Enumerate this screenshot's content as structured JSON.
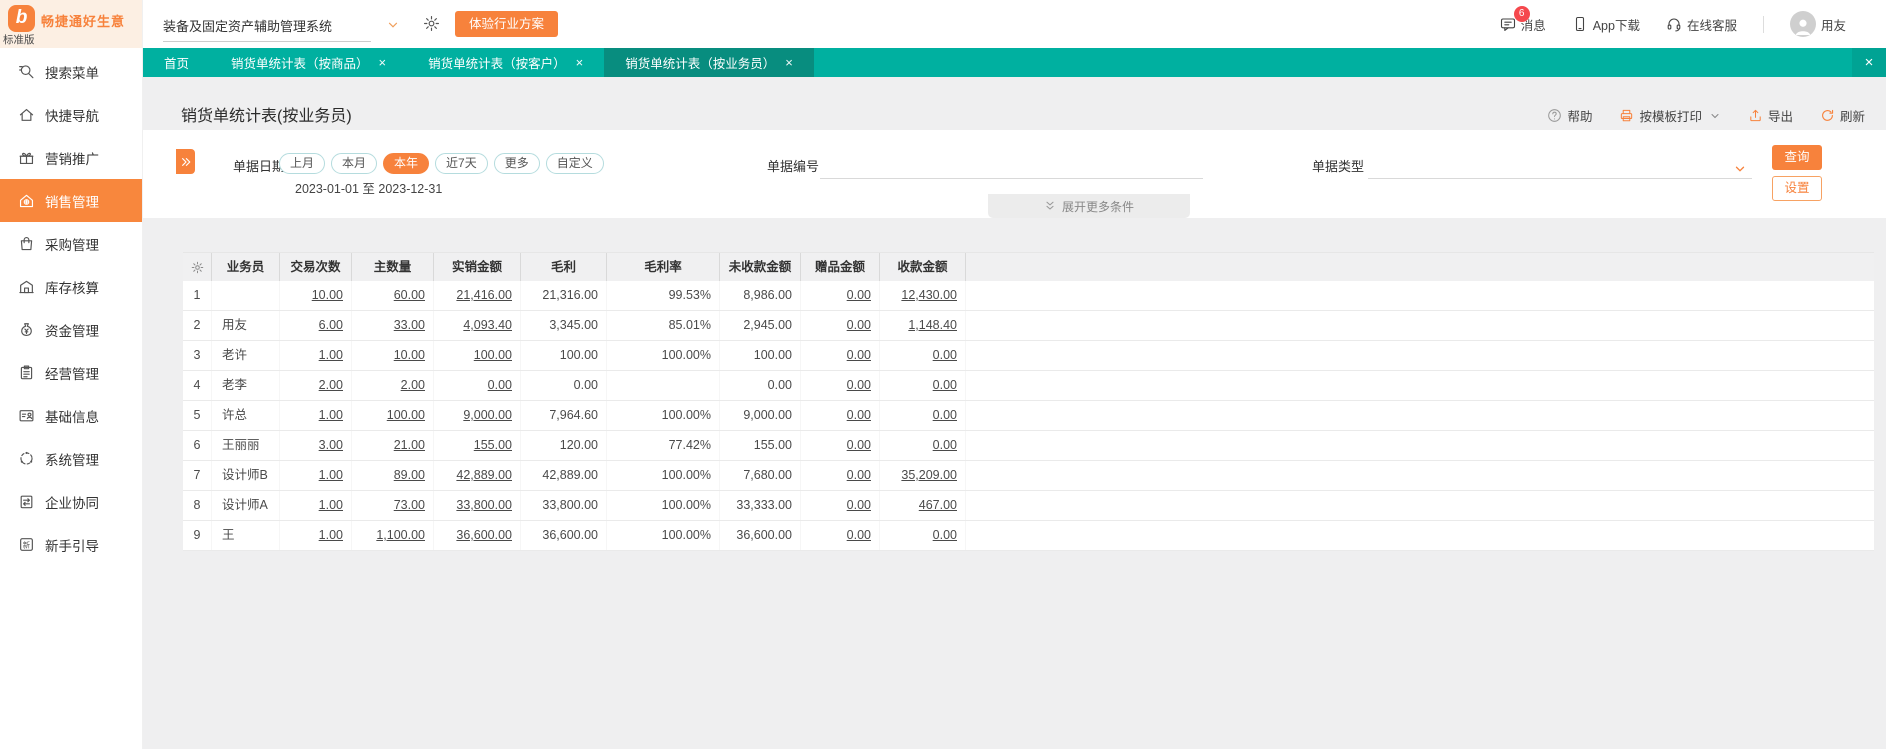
{
  "brand": {
    "logo_glyph": "b",
    "name": "畅捷通好生意",
    "edition": "标准版"
  },
  "topbar": {
    "system_select": "装备及固定资产辅助管理系统",
    "trial_button": "体验行业方案",
    "messages": "消息",
    "messages_badge": "6",
    "app_download": "App下载",
    "online_service": "在线客服",
    "username": "用友"
  },
  "tabbar": {
    "close_glyph": "×"
  },
  "tabs": [
    {
      "label": "首页",
      "closable": false,
      "active": false
    },
    {
      "label": "销货单统计表（按商品）",
      "closable": true,
      "active": false
    },
    {
      "label": "销货单统计表（按客户）",
      "closable": true,
      "active": false
    },
    {
      "label": "销货单统计表（按业务员）",
      "closable": true,
      "active": true
    }
  ],
  "sidebar": {
    "items": [
      {
        "label": "搜索菜单",
        "icon": "search-icon",
        "active": false
      },
      {
        "label": "快捷导航",
        "icon": "home-icon",
        "active": false
      },
      {
        "label": "营销推广",
        "icon": "gift-icon",
        "active": false
      },
      {
        "label": "销售管理",
        "icon": "sales-icon",
        "active": true
      },
      {
        "label": "采购管理",
        "icon": "purchase-bag-icon",
        "active": false
      },
      {
        "label": "库存核算",
        "icon": "warehouse-icon",
        "active": false
      },
      {
        "label": "资金管理",
        "icon": "money-bag-icon",
        "active": false
      },
      {
        "label": "经营管理",
        "icon": "report-clipboard-icon",
        "active": false
      },
      {
        "label": "基础信息",
        "icon": "id-card-icon",
        "active": false
      },
      {
        "label": "系统管理",
        "icon": "system-icon",
        "active": false
      },
      {
        "label": "企业协同",
        "icon": "collaboration-icon",
        "active": false
      },
      {
        "label": "新手引导",
        "icon": "guide-icon",
        "active": false
      }
    ]
  },
  "page": {
    "title": "销货单统计表(按业务员)",
    "toolbar": {
      "help": "帮助",
      "print": "按模板打印",
      "export": "导出",
      "refresh": "刷新"
    }
  },
  "filters": {
    "date_label": "单据日期",
    "date_pills": [
      {
        "label": "上月",
        "active": false
      },
      {
        "label": "本月",
        "active": false
      },
      {
        "label": "本年",
        "active": true
      },
      {
        "label": "近7天",
        "active": false
      },
      {
        "label": "更多",
        "active": false
      },
      {
        "label": "自定义",
        "active": false
      }
    ],
    "date_range": "2023-01-01 至 2023-12-31",
    "doc_no_label": "单据编号",
    "doc_no_value": "",
    "doc_type_label": "单据类型",
    "doc_type_value": "",
    "search_button": "查询",
    "settings_button": "设置",
    "expand_more": "展开更多条件"
  },
  "table": {
    "columns": [
      "业务员",
      "交易次数",
      "主数量",
      "实销金额",
      "毛利",
      "毛利率",
      "未收款金额",
      "赠品金额",
      "收款金额"
    ],
    "rows": [
      {
        "num": "1",
        "name": "",
        "trades": "10.00",
        "qty": "60.00",
        "sales": "21,416.00",
        "profit": "21,316.00",
        "margin": "99.53%",
        "unpaid": "8,986.00",
        "gift": "0.00",
        "received": "12,430.00"
      },
      {
        "num": "2",
        "name": "用友",
        "trades": "6.00",
        "qty": "33.00",
        "sales": "4,093.40",
        "profit": "3,345.00",
        "margin": "85.01%",
        "unpaid": "2,945.00",
        "gift": "0.00",
        "received": "1,148.40"
      },
      {
        "num": "3",
        "name": "老许",
        "trades": "1.00",
        "qty": "10.00",
        "sales": "100.00",
        "profit": "100.00",
        "margin": "100.00%",
        "unpaid": "100.00",
        "gift": "0.00",
        "received": "0.00"
      },
      {
        "num": "4",
        "name": "老李",
        "trades": "2.00",
        "qty": "2.00",
        "sales": "0.00",
        "profit": "0.00",
        "margin": "",
        "unpaid": "0.00",
        "gift": "0.00",
        "received": "0.00"
      },
      {
        "num": "5",
        "name": "许总",
        "trades": "1.00",
        "qty": "100.00",
        "sales": "9,000.00",
        "profit": "7,964.60",
        "margin": "100.00%",
        "unpaid": "9,000.00",
        "gift": "0.00",
        "received": "0.00"
      },
      {
        "num": "6",
        "name": "王丽丽",
        "trades": "3.00",
        "qty": "21.00",
        "sales": "155.00",
        "profit": "120.00",
        "margin": "77.42%",
        "unpaid": "155.00",
        "gift": "0.00",
        "received": "0.00"
      },
      {
        "num": "7",
        "name": "设计师B",
        "trades": "1.00",
        "qty": "89.00",
        "sales": "42,889.00",
        "profit": "42,889.00",
        "margin": "100.00%",
        "unpaid": "7,680.00",
        "gift": "0.00",
        "received": "35,209.00"
      },
      {
        "num": "8",
        "name": "设计师A",
        "trades": "1.00",
        "qty": "73.00",
        "sales": "33,800.00",
        "profit": "33,800.00",
        "margin": "100.00%",
        "unpaid": "33,333.00",
        "gift": "0.00",
        "received": "467.00"
      },
      {
        "num": "9",
        "name": "王",
        "trades": "1.00",
        "qty": "1,100.00",
        "sales": "36,600.00",
        "profit": "36,600.00",
        "margin": "100.00%",
        "unpaid": "36,600.00",
        "gift": "0.00",
        "received": "0.00"
      }
    ]
  }
}
